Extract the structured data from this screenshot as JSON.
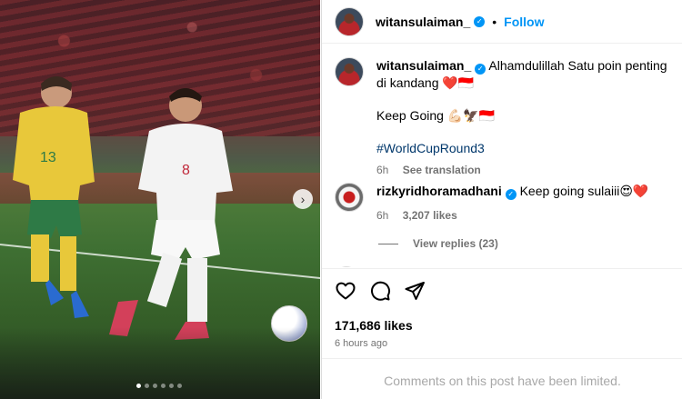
{
  "post": {
    "username": "witansulaiman_",
    "follow_label": "Follow",
    "header_separator": "•",
    "caption": {
      "line1": "Alhamdulillah Satu poin penting di kandang ❤️🇮🇩",
      "line2": "Keep Going 💪🏻🦅🇮🇩",
      "hashtag": "#WorldCupRound3",
      "age": "6h",
      "see_translation": "See translation"
    },
    "photo": {
      "player_left_number": "13",
      "player_right_number": "8",
      "carousel_dot_count": 6,
      "carousel_active_index": 0
    }
  },
  "comments": [
    {
      "username": "rizkyridhoramadhani",
      "text": "Keep going sulaiii😍❤️",
      "age": "6h",
      "likes": "3,207 likes",
      "replies_label": "View replies (23)"
    }
  ],
  "actions": {
    "like_icon": "heart-icon",
    "comment_icon": "comment-icon",
    "share_icon": "share-icon",
    "likes_count": "171,686 likes",
    "posted_ago": "6 hours ago"
  },
  "footer": {
    "limited_notice": "Comments on this post have been limited."
  },
  "colors": {
    "accent": "#0095f6",
    "muted": "#737373",
    "hashtag": "#00376b"
  }
}
